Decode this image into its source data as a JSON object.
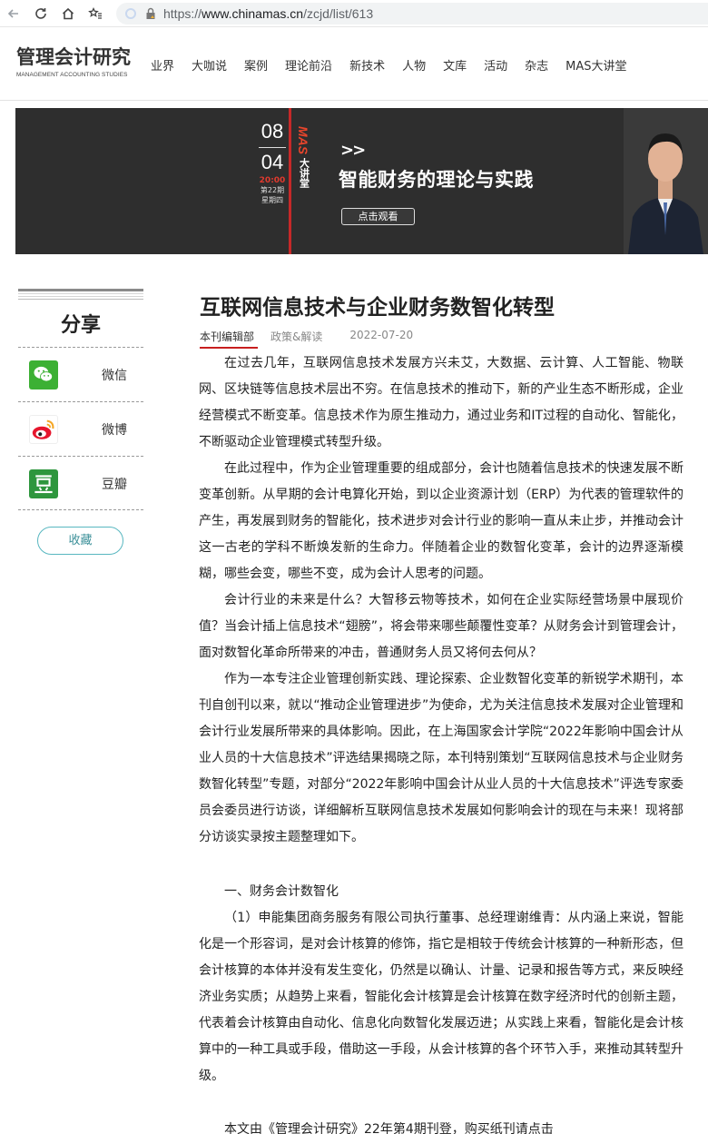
{
  "browser": {
    "url_host": "www.chinamas.cn",
    "url_path": "/zcjd/list/613",
    "url_scheme": "https://"
  },
  "site": {
    "logo_cn": "管理会计研究",
    "logo_en": "MANAGEMENT ACCOUNTING STUDIES",
    "nav": [
      "业界",
      "大咖说",
      "案例",
      "理论前沿",
      "新技术",
      "人物",
      "文库",
      "活动",
      "杂志",
      "MAS大讲堂"
    ]
  },
  "banner": {
    "month": "08",
    "day": "04",
    "time": "20:00",
    "issue": "第22期",
    "weekday": "星期四",
    "brand": "MAS",
    "brand_sub": "大讲堂",
    "arrows": ">>",
    "title": "智能财务的理论与实践",
    "cta": "点击观看"
  },
  "share": {
    "title": "分享",
    "items": [
      {
        "label": "微信",
        "icon": "wechat-icon",
        "color": "#3cb034"
      },
      {
        "label": "微博",
        "icon": "weibo-icon",
        "color": "#e6162d"
      },
      {
        "label": "豆瓣",
        "icon": "douban-icon",
        "color": "#2e963d"
      }
    ],
    "favorite": "收藏"
  },
  "article": {
    "title": "互联网信息技术与企业财务数智化转型",
    "author": "本刊编辑部",
    "category": "政策&解读",
    "date": "2022-07-20",
    "paragraphs": [
      "在过去几年，互联网信息技术发展方兴未艾，大数据、云计算、人工智能、物联网、区块链等信息技术层出不穷。在信息技术的推动下，新的产业生态不断形成，企业经营模式不断变革。信息技术作为原生推动力，通过业务和IT过程的自动化、智能化，不断驱动企业管理模式转型升级。",
      "在此过程中，作为企业管理重要的组成部分，会计也随着信息技术的快速发展不断变革创新。从早期的会计电算化开始，到以企业资源计划（ERP）为代表的管理软件的产生，再发展到财务的智能化，技术进步对会计行业的影响一直从未止步，并推动会计这一古老的学科不断焕发新的生命力。伴随着企业的数智化变革，会计的边界逐渐模糊，哪些会变，哪些不变，成为会计人思考的问题。",
      "会计行业的未来是什么？大智移云物等技术，如何在企业实际经营场景中展现价值？当会计插上信息技术“翅膀”，将会带来哪些颠覆性变革？从财务会计到管理会计，面对数智化革命所带来的冲击，普通财务人员又将何去何从？",
      "作为一本专注企业管理创新实践、理论探索、企业数智化变革的新锐学术期刊，本刊自创刊以来，就以“推动企业管理进步”为使命，尤为关注信息技术发展对企业管理和会计行业发展所带来的具体影响。因此，在上海国家会计学院“2022年影响中国会计从业人员的十大信息技术”评选结果揭晓之际，本刊特别策划“互联网信息技术与企业财务数智化转型”专题，对部分“2022年影响中国会计从业人员的十大信息技术”评选专家委员会委员进行访谈，详细解析互联网信息技术发展如何影响会计的现在与未来！现将部分访谈实录按主题整理如下。"
    ],
    "section_heading": "一、财务会计数智化",
    "section_paragraph": "（1）申能集团商务服务有限公司执行董事、总经理谢维青：从内涵上来说，智能化是一个形容词，是对会计核算的修饰，指它是相较于传统会计核算的一种新形态，但会计核算的本体并没有发生变化，仍然是以确认、计量、记录和报告等方式，来反映经济业务实质；从趋势上来看，智能化会计核算是会计核算在数字经济时代的创新主题，代表着会计核算由自动化、信息化向数智化发展迈进；从实践上来看，智能化是会计核算中的一种工具或手段，借助这一手段，从会计核算的各个环节入手，来推动其转型升级。",
    "footer_note": "本文由《管理会计研究》22年第4期刊登，购买纸刊请点击"
  }
}
